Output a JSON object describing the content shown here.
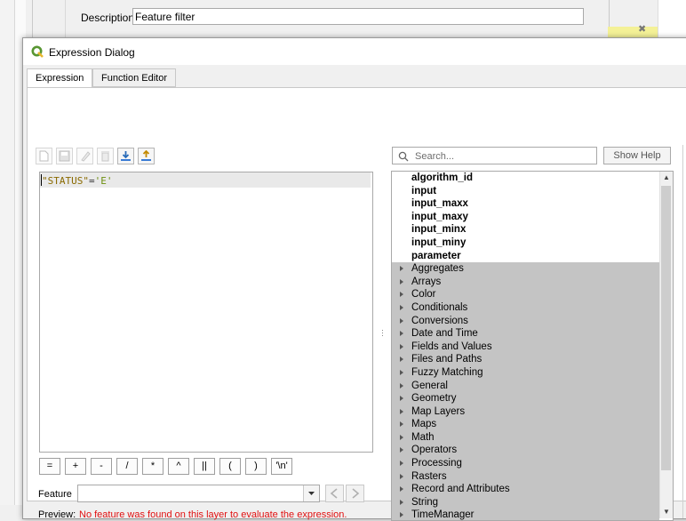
{
  "background": {
    "description_label": "Description",
    "description_value": "Feature filter"
  },
  "dialog": {
    "title": "Expression Dialog",
    "tabs": [
      {
        "label": "Expression",
        "active": true
      },
      {
        "label": "Function Editor",
        "active": false
      }
    ]
  },
  "toolbar": {
    "icons": [
      "new-file-icon",
      "save-icon",
      "edit-icon",
      "delete-icon",
      "import-icon",
      "export-icon"
    ]
  },
  "editor": {
    "expression_field": "\"STATUS\"",
    "expression_op": "=",
    "expression_string": "'E'"
  },
  "operators": [
    "=",
    "+",
    "-",
    "/",
    "*",
    "^",
    "||",
    "(",
    ")",
    "'\\n'"
  ],
  "feature": {
    "label": "Feature",
    "value": ""
  },
  "preview": {
    "label": "Preview:",
    "message": "No feature was found on this layer to evaluate the expression."
  },
  "search": {
    "placeholder": "Search..."
  },
  "help_button": "Show Help",
  "variables": [
    "algorithm_id",
    "input",
    "input_maxx",
    "input_maxy",
    "input_minx",
    "input_miny",
    "parameter"
  ],
  "groups": [
    "Aggregates",
    "Arrays",
    "Color",
    "Conditionals",
    "Conversions",
    "Date and Time",
    "Fields and Values",
    "Files and Paths",
    "Fuzzy Matching",
    "General",
    "Geometry",
    "Map Layers",
    "Maps",
    "Math",
    "Operators",
    "Processing",
    "Rasters",
    "Record and Attributes",
    "String",
    "TimeManager"
  ],
  "colors": {
    "qgis_green": "#589632",
    "error_red": "#e01010",
    "group_bg": "#c4c4c4"
  }
}
